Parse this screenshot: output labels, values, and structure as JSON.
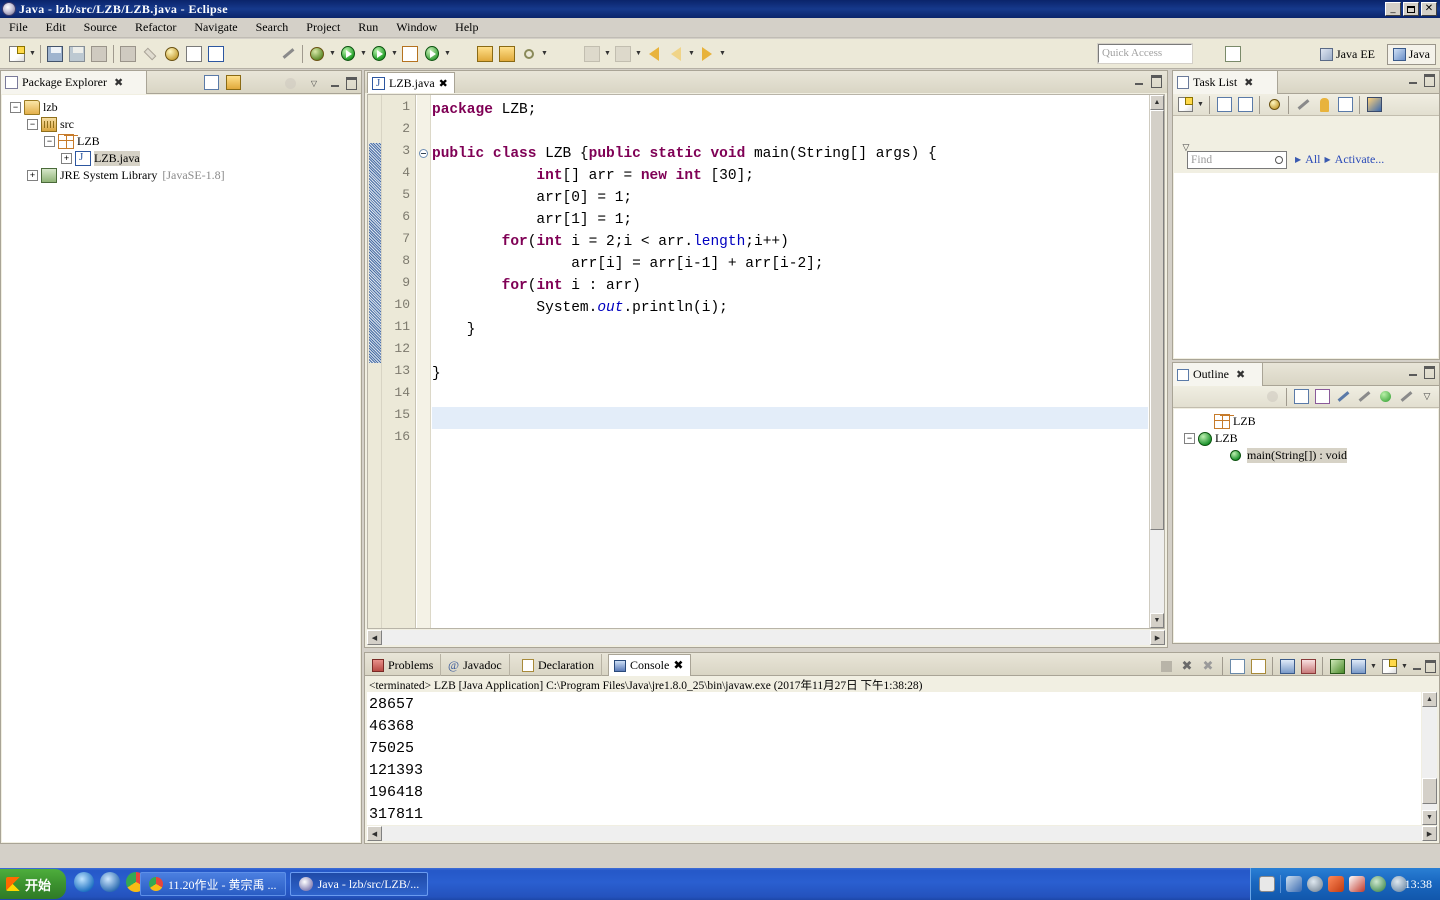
{
  "window": {
    "title": "Java - lzb/src/LZB/LZB.java - Eclipse",
    "minimize_label": "_",
    "restore_label": "❐",
    "close_label": "✕"
  },
  "menubar": {
    "items": [
      {
        "label": "File"
      },
      {
        "label": "Edit"
      },
      {
        "label": "Source"
      },
      {
        "label": "Refactor"
      },
      {
        "label": "Navigate"
      },
      {
        "label": "Search"
      },
      {
        "label": "Project"
      },
      {
        "label": "Run"
      },
      {
        "label": "Window"
      },
      {
        "label": "Help"
      }
    ]
  },
  "toolbar": {
    "quick_access_placeholder": "Quick Access",
    "perspectives": [
      {
        "label": "Java EE",
        "active": false
      },
      {
        "label": "Java",
        "active": true
      }
    ],
    "icons": [
      "new-wizard-icon",
      "save-icon",
      "save-all-icon",
      "print-icon",
      "build-all-icon",
      "link-icon",
      "debug-last-icon",
      "open-task-icon",
      "new-java-class-icon",
      "external-tools-icon",
      "debug-icon",
      "run-icon",
      "coverage-icon",
      "new-java-project-icon",
      "search-icon",
      "open-type-icon",
      "open-task-2-icon",
      "annotation-icon",
      "next-annotation-icon",
      "previous-annotation-icon",
      "back-icon",
      "forward-icon",
      "next-edit-icon"
    ]
  },
  "package_explorer": {
    "tab_label": "Package Explorer",
    "toolbar_icons": [
      "collapse-all-icon",
      "link-with-editor-icon",
      "focus-icon",
      "view-menu-icon"
    ],
    "tree": [
      {
        "label": "lzb",
        "icon": "project-folder-icon",
        "indent": 0,
        "expander": "-"
      },
      {
        "label": "src",
        "icon": "source-folder-icon",
        "indent": 1,
        "expander": "-"
      },
      {
        "label": "LZB",
        "icon": "package-icon",
        "indent": 2,
        "expander": "-"
      },
      {
        "label": "LZB.java",
        "icon": "java-file-icon",
        "indent": 3,
        "expander": "+",
        "selected": true
      },
      {
        "label": "JRE System Library",
        "secondary": "[JavaSE-1.8]",
        "icon": "jre-library-icon",
        "indent": 1,
        "expander": "+"
      }
    ]
  },
  "editor": {
    "tab_label": "LZB.java",
    "tab_icon": "java-file-icon",
    "current_line": 15,
    "lines": [
      {
        "n": 1,
        "tokens": [
          {
            "t": "package ",
            "c": "kw"
          },
          {
            "t": "LZB;",
            "c": ""
          }
        ]
      },
      {
        "n": 2,
        "tokens": []
      },
      {
        "n": 3,
        "fold": true,
        "tokens": [
          {
            "t": "public class ",
            "c": "kw"
          },
          {
            "t": "LZB {",
            "c": ""
          },
          {
            "t": "public static void ",
            "c": "kw"
          },
          {
            "t": "main(String[] args) {",
            "c": ""
          }
        ]
      },
      {
        "n": 4,
        "tokens": [
          {
            "t": "            ",
            "c": ""
          },
          {
            "t": "int",
            "c": "kw"
          },
          {
            "t": "[] arr = ",
            "c": ""
          },
          {
            "t": "new int",
            "c": "kw"
          },
          {
            "t": " [30];",
            "c": ""
          }
        ]
      },
      {
        "n": 5,
        "tokens": [
          {
            "t": "            arr[0] = 1;",
            "c": ""
          }
        ]
      },
      {
        "n": 6,
        "tokens": [
          {
            "t": "            arr[1] = 1;",
            "c": ""
          }
        ]
      },
      {
        "n": 7,
        "tokens": [
          {
            "t": "        ",
            "c": ""
          },
          {
            "t": "for",
            "c": "kw"
          },
          {
            "t": "(",
            "c": ""
          },
          {
            "t": "int",
            "c": "kw"
          },
          {
            "t": " i = 2;i < arr.",
            "c": ""
          },
          {
            "t": "length",
            "c": "fld2"
          },
          {
            "t": ";i++)",
            "c": ""
          }
        ]
      },
      {
        "n": 8,
        "tokens": [
          {
            "t": "                arr[i] = arr[i-1] + arr[i-2];",
            "c": ""
          }
        ]
      },
      {
        "n": 9,
        "tokens": [
          {
            "t": "        ",
            "c": ""
          },
          {
            "t": "for",
            "c": "kw"
          },
          {
            "t": "(",
            "c": ""
          },
          {
            "t": "int",
            "c": "kw"
          },
          {
            "t": " i : arr)",
            "c": ""
          }
        ]
      },
      {
        "n": 10,
        "tokens": [
          {
            "t": "            System.",
            "c": ""
          },
          {
            "t": "out",
            "c": "fld"
          },
          {
            "t": ".println(i);",
            "c": ""
          }
        ]
      },
      {
        "n": 11,
        "tokens": [
          {
            "t": "    }",
            "c": ""
          }
        ]
      },
      {
        "n": 12,
        "tokens": []
      },
      {
        "n": 13,
        "tokens": [
          {
            "t": "}",
            "c": ""
          }
        ]
      },
      {
        "n": 14,
        "tokens": []
      },
      {
        "n": 15,
        "tokens": []
      },
      {
        "n": 16,
        "tokens": []
      }
    ]
  },
  "task_list": {
    "tab_label": "Task List",
    "find_placeholder": "Find",
    "filter_all": "All",
    "filter_activate": "Activate...",
    "toolbar_icons": [
      "new-task-icon",
      "categorize-icon",
      "schedule-icon",
      "focus-icon",
      "filter-icon",
      "collapse-icon",
      "restore-icon",
      "view-menu-icon"
    ]
  },
  "outline": {
    "tab_label": "Outline",
    "toolbar_icons": [
      "focus-icon",
      "collapse-all-icon",
      "sort-icon",
      "hide-fields-icon",
      "hide-static-icon",
      "hide-nonpublic-icon",
      "hide-local-icon",
      "view-menu-icon"
    ],
    "tree": [
      {
        "label": "LZB",
        "icon": "package-icon",
        "indent": 0,
        "expander": ""
      },
      {
        "label": "LZB",
        "icon": "class-icon",
        "indent": 0,
        "expander": "-"
      },
      {
        "label": "main(String[]) : void",
        "icon": "method-public-static-icon",
        "indent": 1,
        "expander": "",
        "selected": true
      }
    ]
  },
  "console_panel": {
    "tabs": [
      {
        "label": "Problems",
        "icon": "problems-icon",
        "active": false
      },
      {
        "label": "Javadoc",
        "icon": "javadoc-icon",
        "active": false
      },
      {
        "label": "Declaration",
        "icon": "declaration-icon",
        "active": false
      },
      {
        "label": "Console",
        "icon": "console-icon",
        "active": true
      }
    ],
    "toolbar_icons": [
      "terminate-icon",
      "remove-launch-icon",
      "remove-all-launches-icon",
      "clear-console-icon",
      "lock-scroll-icon",
      "show-console-icon",
      "display-selected-console-icon",
      "pin-console-icon",
      "open-console-icon",
      "new-console-view-icon",
      "minimize-icon",
      "maximize-icon"
    ],
    "header": "<terminated> LZB [Java Application] C:\\Program Files\\Java\\jre1.8.0_25\\bin\\javaw.exe (2017年11月27日 下午1:38:28)",
    "output": [
      "28657",
      "46368",
      "75025",
      "121393",
      "196418",
      "317811"
    ]
  },
  "taskbar": {
    "start_label": "开始",
    "quick_launch": [
      "internet-explorer-icon",
      "media-player-icon",
      "chrome-icon"
    ],
    "windows": [
      {
        "label": "11.20作业 - 黄宗禹 ...",
        "icon": "chrome-icon",
        "active": false
      },
      {
        "label": "Java - lzb/src/LZB/...",
        "icon": "eclipse-icon",
        "active": true
      }
    ],
    "tray_icons": [
      "keyboard-icon",
      "network-icon",
      "shield-icon",
      "volume-icon",
      "antivirus-icon",
      "update-icon",
      "clock-icon"
    ],
    "clock": "13:38"
  },
  "colors": {
    "keyword": "#7f0055",
    "field": "#0000c0",
    "title_bar": "#0a246a",
    "panel_bg": "#f1efe2",
    "editor_bg": "#ffffff",
    "highlight_line": "#e3edf9",
    "taskbar": "#2558c8"
  }
}
